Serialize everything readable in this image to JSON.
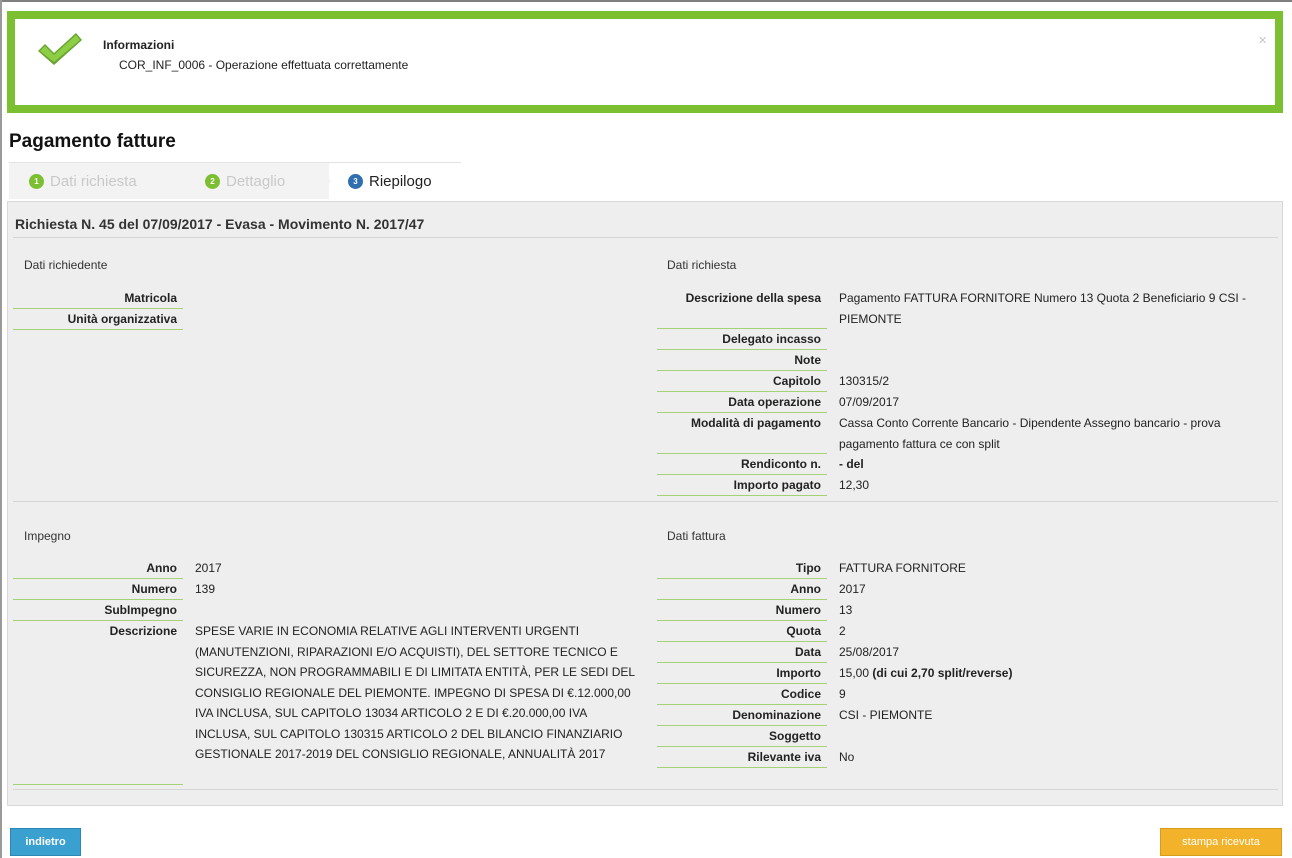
{
  "alert": {
    "title": "Informazioni",
    "message": "COR_INF_0006 - Operazione effettuata correttamente",
    "close": "×",
    "icon": "check-icon",
    "color": "#7cbf30"
  },
  "page_title": "Pagamento fatture",
  "steps": [
    {
      "num": "1",
      "label": "Dati richiesta",
      "state": "done"
    },
    {
      "num": "2",
      "label": "Dettaglio",
      "state": "done"
    },
    {
      "num": "3",
      "label": "Riepilogo",
      "state": "current"
    }
  ],
  "summary_title": "Richiesta N. 45 del 07/09/2017 - Evasa - Movimento N. 2017/47",
  "dati_richiedente": {
    "title": "Dati richiedente",
    "fields": [
      {
        "label": "Matricola",
        "value": ""
      },
      {
        "label": "Unità organizzativa",
        "value": ""
      }
    ]
  },
  "dati_richiesta": {
    "title": "Dati richiesta",
    "fields": [
      {
        "label": "Descrizione della spesa",
        "value": "Pagamento FATTURA FORNITORE Numero 13 Quota 2 Beneficiario 9 CSI - PIEMONTE"
      },
      {
        "label": "Delegato incasso",
        "value": ""
      },
      {
        "label": "Note",
        "value": ""
      },
      {
        "label": "Capitolo",
        "value": "130315/2"
      },
      {
        "label": "Data operazione",
        "value": "07/09/2017"
      },
      {
        "label": "Modalità di pagamento",
        "value": "Cassa Conto Corrente Bancario - Dipendente Assegno bancario - prova pagamento fattura ce con split"
      },
      {
        "label": "Rendiconto n.",
        "value": "- del"
      },
      {
        "label": "Importo pagato",
        "value": "12,30"
      }
    ]
  },
  "impegno": {
    "title": "Impegno",
    "fields": [
      {
        "label": "Anno",
        "value": "2017"
      },
      {
        "label": "Numero",
        "value": "139"
      },
      {
        "label": "SubImpegno",
        "value": ""
      },
      {
        "label": "Descrizione",
        "value": "SPESE VARIE IN ECONOMIA RELATIVE AGLI INTERVENTI URGENTI (MANUTENZIONI, RIPARAZIONI E/O ACQUISTI), DEL SETTORE TECNICO E SICUREZZA, NON PROGRAMMABILI E DI LIMITATA ENTITÀ, PER LE SEDI DEL CONSIGLIO REGIONALE DEL PIEMONTE. IMPEGNO DI SPESA DI €.12.000,00 IVA INCLUSA, SUL CAPITOLO 13034 ARTICOLO 2 E DI €.20.000,00 IVA INCLUSA, SUL CAPITOLO 130315 ARTICOLO 2 DEL BILANCIO FINANZIARIO GESTIONALE 2017-2019 DEL CONSIGLIO REGIONALE, ANNUALITÀ 2017"
      }
    ]
  },
  "dati_fattura": {
    "title": "Dati fattura",
    "fields": [
      {
        "label": "Tipo",
        "value": "FATTURA FORNITORE"
      },
      {
        "label": "Anno",
        "value": "2017"
      },
      {
        "label": "Numero",
        "value": "13"
      },
      {
        "label": "Quota",
        "value": "2"
      },
      {
        "label": "Data",
        "value": "25/08/2017"
      },
      {
        "label": "Importo",
        "value": "15,00",
        "extra": "(di cui 2,70 split/reverse)"
      },
      {
        "label": "Codice",
        "value": "9"
      },
      {
        "label": "Denominazione",
        "value": "CSI - PIEMONTE"
      },
      {
        "label": "Soggetto",
        "value": ""
      },
      {
        "label": "Rilevante iva",
        "value": "No"
      }
    ]
  },
  "buttons": {
    "back": "indietro",
    "print": "stampa ricevuta"
  }
}
